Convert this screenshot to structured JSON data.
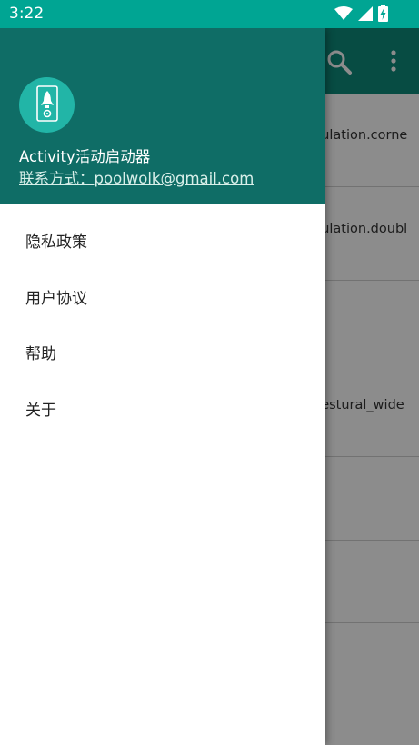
{
  "statusbar": {
    "time": "3:22"
  },
  "drawer": {
    "app_name": "Activity活动启动器",
    "contact": "联系方式：poolwolk@gmail.com",
    "menu": [
      {
        "label": "隐私政策"
      },
      {
        "label": "用户协议"
      },
      {
        "label": "帮助"
      },
      {
        "label": "关于"
      }
    ]
  },
  "background_list": [
    {
      "text": "nulation.corne"
    },
    {
      "text": "nulation.doubl"
    },
    {
      "text": ""
    },
    {
      "text": "gestural_wide"
    },
    {
      "text": ""
    },
    {
      "text": ""
    }
  ],
  "colors": {
    "statusbar": "#00a593",
    "toolbar": "#0e8a7b",
    "drawer_header": "#0f6d66",
    "avatar": "#22b5a7"
  }
}
